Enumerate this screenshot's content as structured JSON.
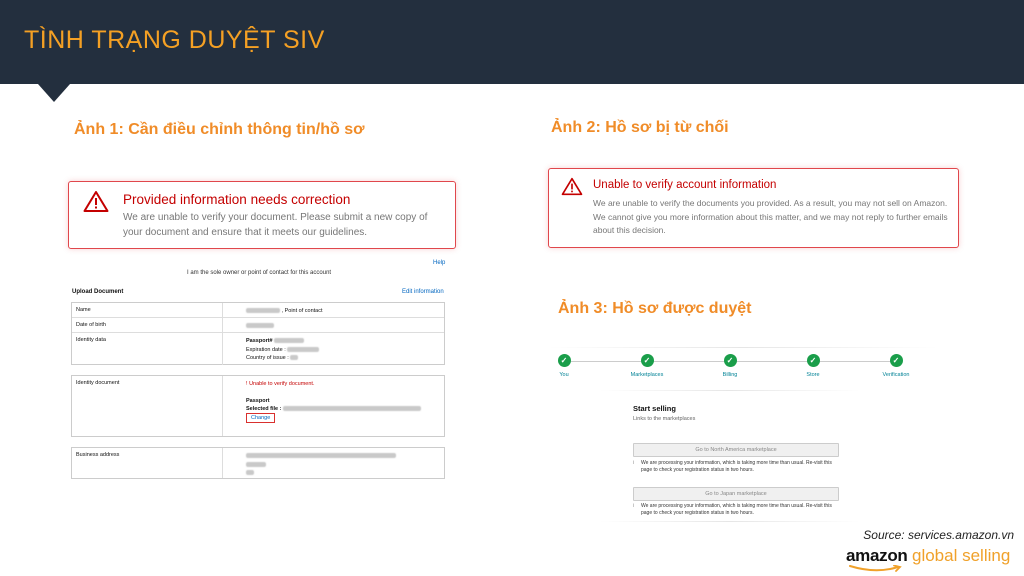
{
  "header": {
    "title": "TÌNH TRẠNG DUYỆT SIV"
  },
  "panel1": {
    "title": "Ảnh 1: Cần điều chỉnh thông tin/hồ sơ",
    "alert": {
      "heading": "Provided information needs correction",
      "body": "We are unable to verify your document. Please submit a new copy of your document and ensure that it meets our guidelines."
    },
    "form": {
      "help_link": "Help",
      "owner_note": "I am the sole owner or point of contact for this account",
      "upload_header": "Upload Document",
      "edit_link": "Edit information",
      "rows": {
        "name_label": "Name",
        "name_suffix": ", Point of contact",
        "dob_label": "Date of birth",
        "identity_label": "Identity data",
        "passport_label": "Passport#",
        "expiration_label": "Expiration date :",
        "country_label": "Country of issue :",
        "doc_label": "Identity document",
        "doc_error": "Unable to verify document.",
        "doc_type": "Passport",
        "selected_file_label": "Selected file :",
        "change_button": "Change",
        "address_label": "Business address"
      }
    }
  },
  "panel2": {
    "title": "Ảnh 2: Hồ sơ bị từ chối",
    "alert": {
      "heading": "Unable to verify account information",
      "body": "We are unable to verify the documents you provided. As a result, you may not sell on Amazon. We cannot give you more information about this matter, and we may not reply to further emails about this decision."
    }
  },
  "panel3": {
    "title": "Ảnh 3: Hồ sơ được duyệt",
    "steps": [
      "You",
      "Marketplaces",
      "Billing",
      "Store",
      "Verification"
    ],
    "check_glyph": "✓",
    "start_title": "Start selling",
    "start_sub": "Links to the marketplaces",
    "marketplaces": [
      {
        "button": "Go to North America marketplace",
        "note": "We are processing your information, which is taking more time than usual. Re-visit this page to check your registration status in two hours."
      },
      {
        "button": "Go to Japan marketplace",
        "note": "We are processing your information, which is taking more time than usual. Re-visit this page to check your registration status in two hours."
      }
    ]
  },
  "footer": {
    "source": "Source: services.amazon.vn",
    "logo_amazon": "amazon",
    "logo_global": "global selling"
  },
  "colors": {
    "header_bg": "#232f3e",
    "accent_orange": "#f08c28",
    "alert_red": "#e0474c",
    "step_green": "#1a9e4a"
  }
}
